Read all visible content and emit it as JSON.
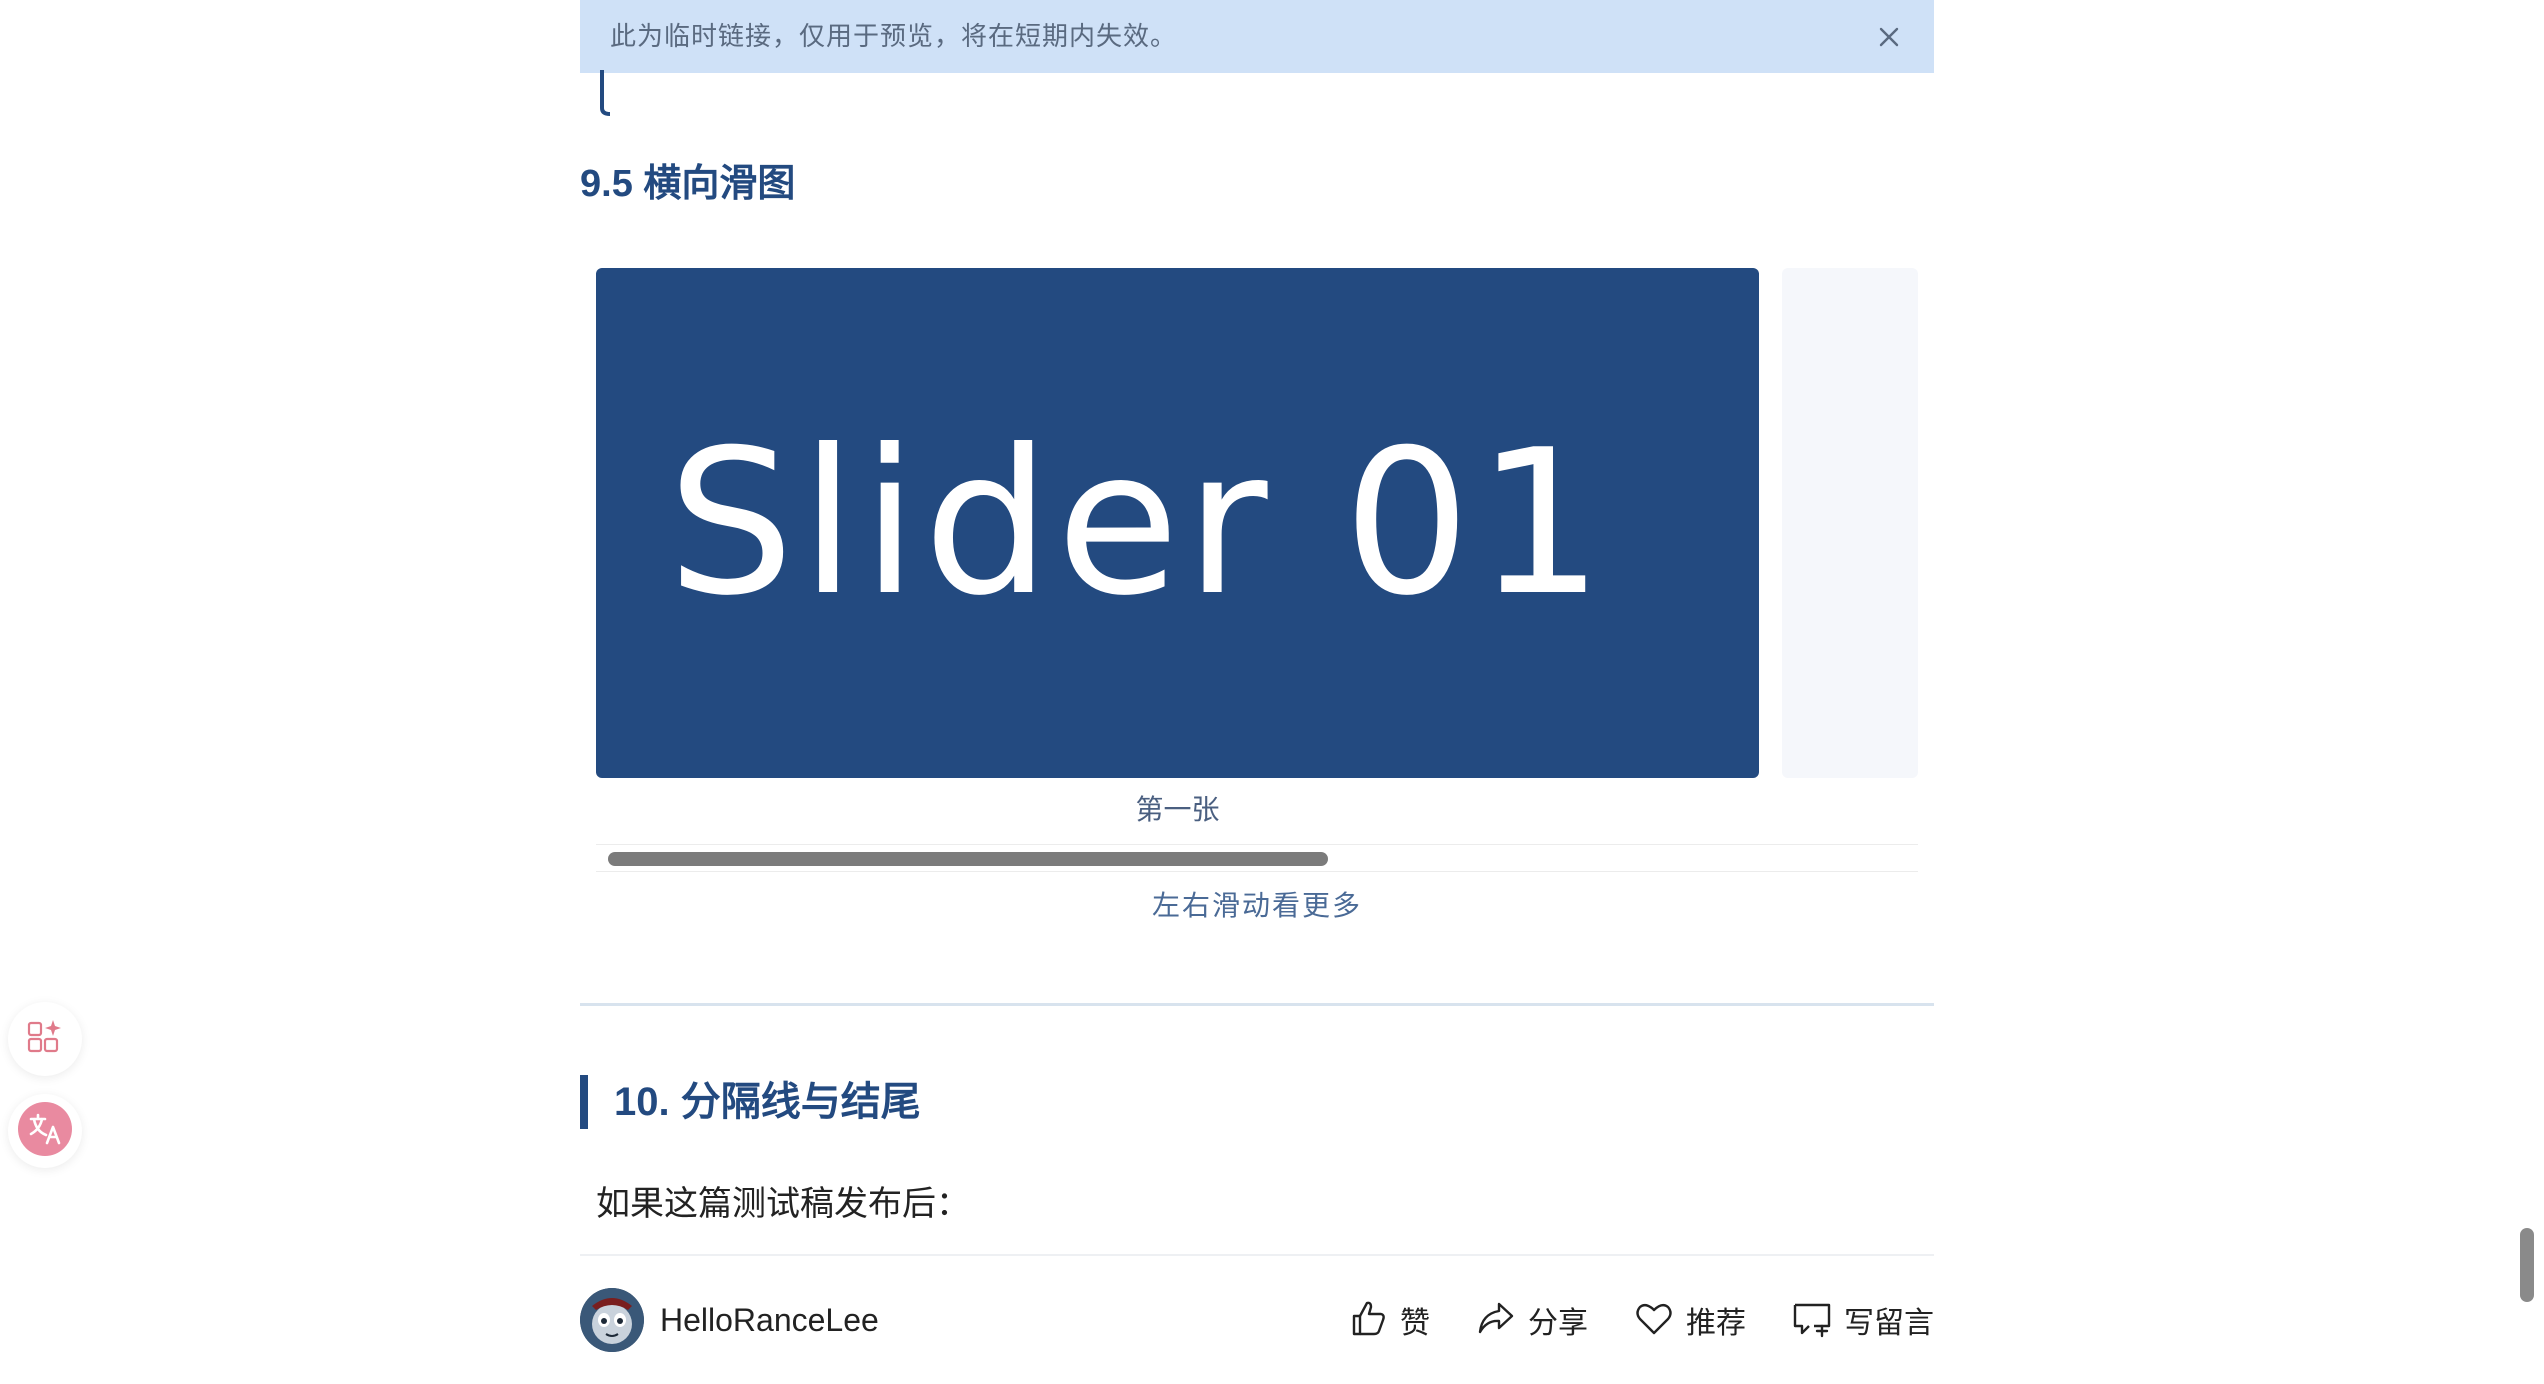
{
  "notice": {
    "text": "此为临时链接，仅用于预览，将在短期内失效。",
    "close_icon": "close-icon"
  },
  "section_95": {
    "title": "9.5 横向滑图"
  },
  "slider": {
    "slide_text": "Slider 01",
    "caption": "第一张",
    "hint": "左右滑动看更多",
    "scroll_position": 0.55,
    "colors": {
      "slide_bg": "#234a80",
      "next_slide_bg": "#f5f7fb"
    }
  },
  "section_10": {
    "title": "10. 分隔线与结尾",
    "paragraph": "如果这篇测试稿发布后："
  },
  "footer": {
    "author_name": "HelloRanceLee",
    "actions": [
      {
        "icon": "thumbs-up-icon",
        "label": "赞"
      },
      {
        "icon": "share-icon",
        "label": "分享"
      },
      {
        "icon": "heart-icon",
        "label": "推荐"
      },
      {
        "icon": "comment-icon",
        "label": "写留言"
      }
    ]
  },
  "floating": {
    "apps_icon": "apps-sparkle-icon",
    "translate_icon": "translate-icon"
  },
  "theme": {
    "accent": "#234a80",
    "notice_bg": "#cfe1f7"
  }
}
